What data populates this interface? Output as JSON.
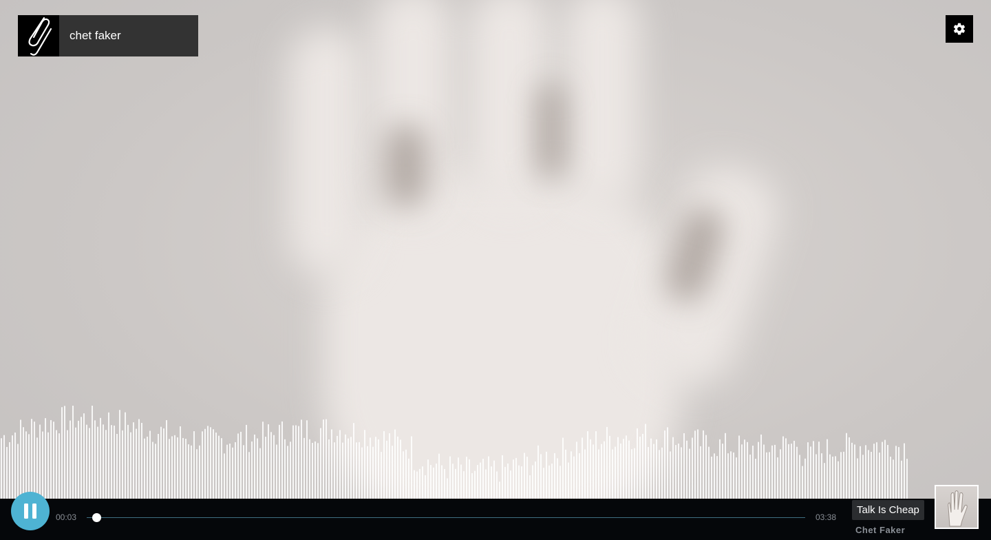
{
  "header": {
    "search_title": "chet faker",
    "logo_icon": "paperclip-logo-icon",
    "settings_icon": "gear-icon"
  },
  "player": {
    "current_time": "00:03",
    "total_time": "03:38",
    "progress_fraction": 0.013,
    "state": "playing",
    "play_pause_icon": "pause-icon",
    "accent_color": "#4eb3d3"
  },
  "now_playing": {
    "title": "Talk Is Cheap",
    "artist": "Chet Faker",
    "art_icon": "album-art-hand"
  }
}
